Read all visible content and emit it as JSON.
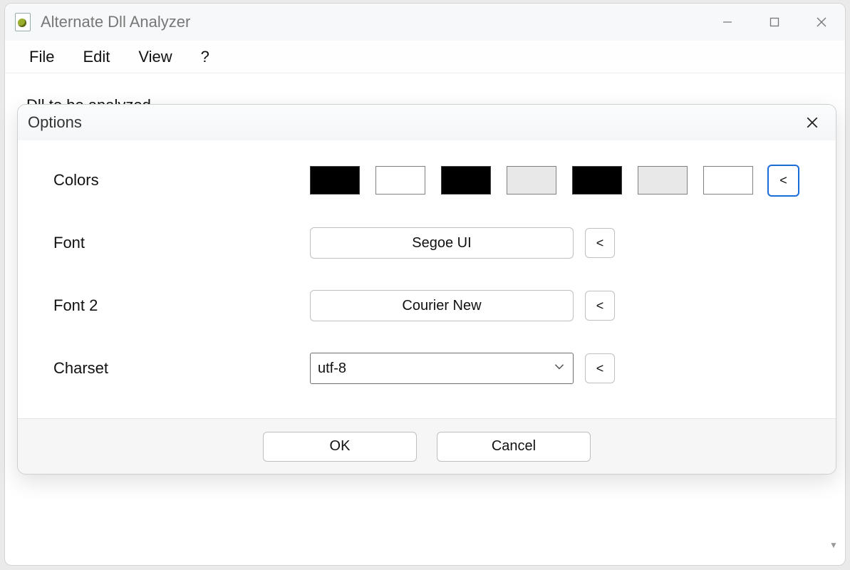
{
  "main": {
    "title": "Alternate Dll Analyzer",
    "menu": {
      "file": "File",
      "edit": "Edit",
      "view": "View",
      "help": "?"
    },
    "body_label": "Dll to be analyzed"
  },
  "dialog": {
    "title": "Options",
    "colors_label": "Colors",
    "colors": [
      "#000000",
      "#ffffff",
      "#000000",
      "#e8e8e8",
      "#000000",
      "#e8e8e8",
      "#ffffff"
    ],
    "colors_reset_glyph": "<",
    "font_label": "Font",
    "font_value": "Segoe UI",
    "font_reset_glyph": "<",
    "font2_label": "Font 2",
    "font2_value": "Courier New",
    "font2_reset_glyph": "<",
    "charset_label": "Charset",
    "charset_value": "utf-8",
    "charset_reset_glyph": "<",
    "ok_label": "OK",
    "cancel_label": "Cancel"
  }
}
